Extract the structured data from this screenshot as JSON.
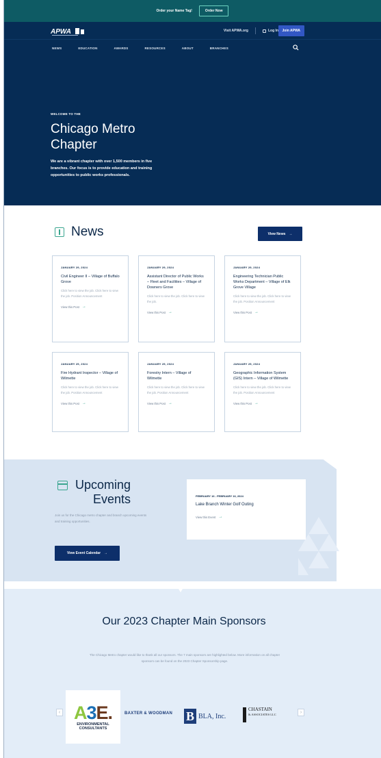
{
  "promo": {
    "text": "Order your Name Tag!",
    "button": "Order Now"
  },
  "header": {
    "logo_text": "APWA",
    "links": {
      "visit": "Visit APWA.org",
      "login": "Log In",
      "join": "Join APWA"
    },
    "nav": [
      "NEWS",
      "EDUCATION",
      "AWARDS",
      "RESOURCES",
      "ABOUT",
      "BRANCHES"
    ]
  },
  "hero": {
    "kicker": "WELCOME TO THE",
    "title": "Chicago Metro Chapter",
    "text": "We are a vibrant chapter with over 1,500 members in five branches. Our focus is to provide education and training opportunities to public works professionals."
  },
  "news": {
    "title": "News",
    "view_all": "View News",
    "cards": [
      {
        "date": "JANUARY 29, 2024",
        "title": "Civil Engineer II – Village of Buffalo Grove",
        "excerpt": "Click here to view the job. Click here to view the job. Position Announcement",
        "link": "View this Post"
      },
      {
        "date": "JANUARY 29, 2024",
        "title": "Assistant Director of Public Works – Fleet and Facilities – Village of Downers Grove",
        "excerpt": "Click here to view the job. Click here to view the job.",
        "link": "View this Post"
      },
      {
        "date": "JANUARY 29, 2024",
        "title": "Engineering Technician Public Works Department – Village of Elk Grove Village",
        "excerpt": "Click here to view the job. Click here to view the job. Position Announcement",
        "link": "View this Post"
      },
      {
        "date": "JANUARY 25, 2024",
        "title": "Fire Hydrant Inspector – Village of Wilmette",
        "excerpt": "Click here to view the job. Click here to view the job. Position Announcement",
        "link": "View this Post"
      },
      {
        "date": "JANUARY 25, 2024",
        "title": "Forestry Intern – Village of Wilmette",
        "excerpt": "Click here to view the job. Click here to view the job. Position Announcement",
        "link": "View this Post"
      },
      {
        "date": "JANUARY 25, 2024",
        "title": "Geographic Information System (GIS) Intern – Village of Wilmette",
        "excerpt": "Click here to view the job. Click here to view the job. Position Announcement",
        "link": "View this Post"
      }
    ]
  },
  "events": {
    "title_line1": "Upcoming",
    "title_line2": "Events",
    "desc": "Join us for the Chicago metro chapter and branch upcoming events and training opportunities.",
    "button": "View Event Calendar",
    "card": {
      "date": "FEBRUARY 16 - FEBRUARY 16, 2024",
      "title": "Lake Branch Winter Golf Outing",
      "link": "View this Event"
    }
  },
  "sponsors": {
    "title": "Our 2023 Chapter Main Sponsors",
    "desc": "The Chicago Metro chapter would like to thank all our sponsors. The 7 main sponsors are highlighted below. More information on all chapter sponsors can be found on the 2023 Chapter Sponsorship page.",
    "prev": "‹",
    "next": "›",
    "a3e": {
      "mark": "A3E.",
      "sub": "ENVIRONMENTAL CONSULTANTS"
    },
    "bw": "BAXTER & WOODMAN",
    "bla": {
      "mark": "B",
      "text": "BLA, Inc."
    },
    "chastain": {
      "name": "CHASTAIN",
      "sub": "& ASSOCIATES LLC"
    }
  }
}
